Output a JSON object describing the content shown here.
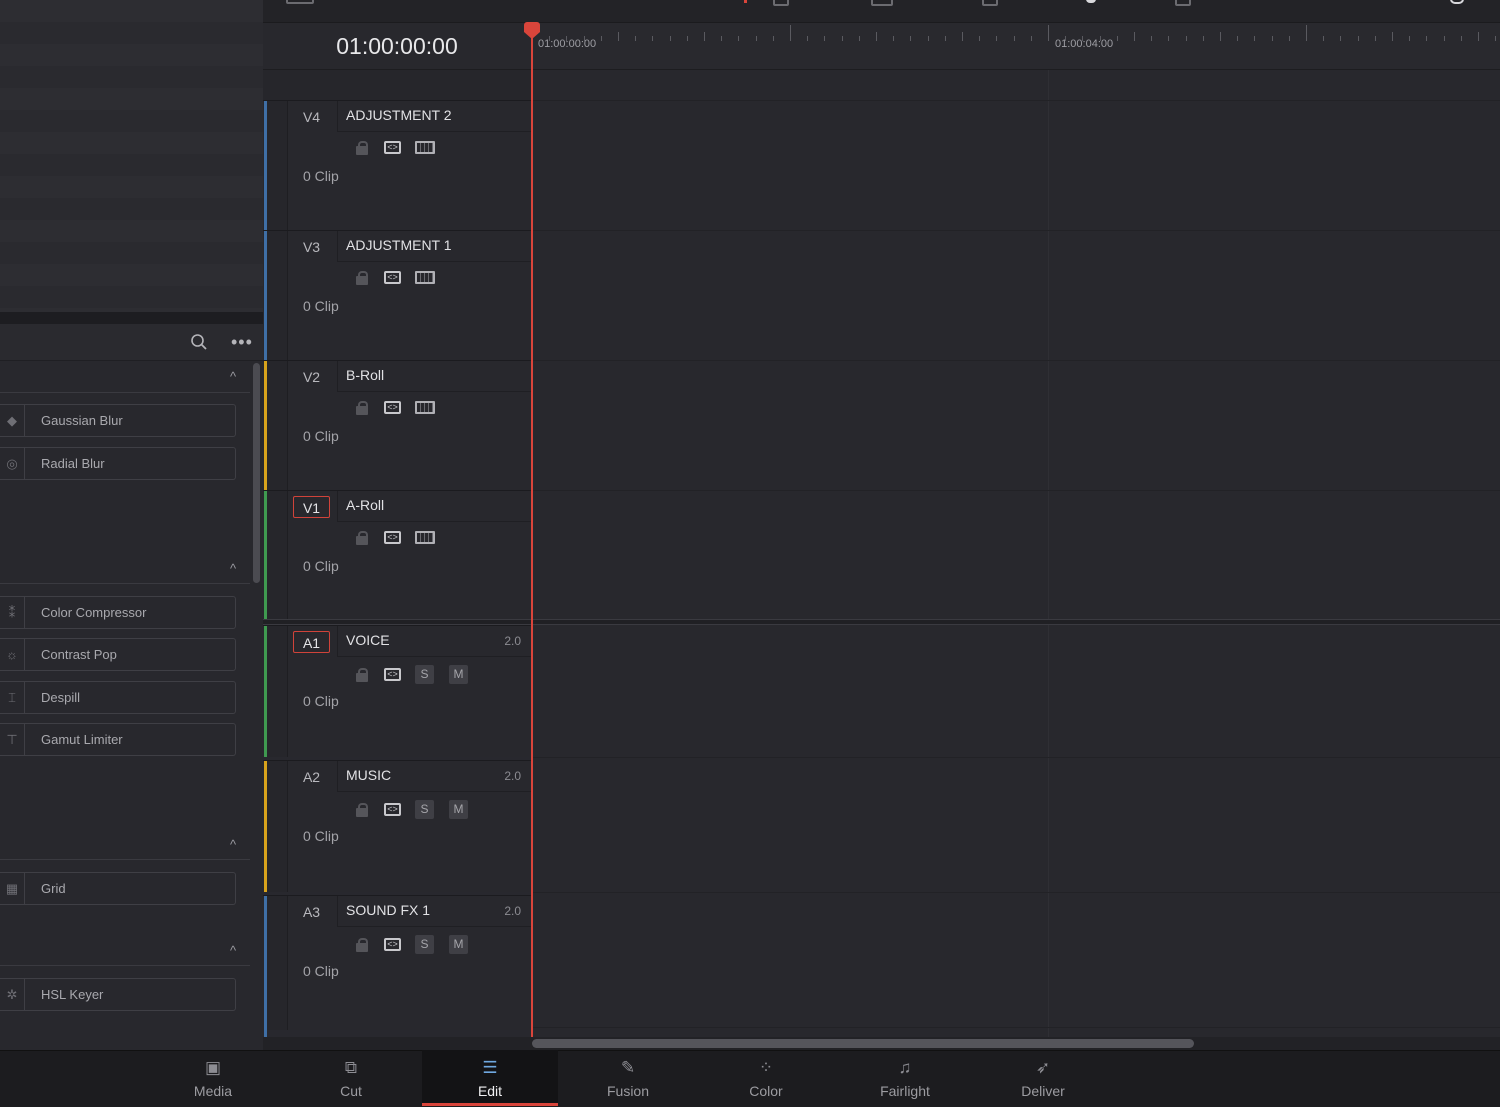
{
  "timeline": {
    "timecode": "01:00:00:00",
    "ruler_labels": [
      "01:00:00:00",
      "01:00:04:00"
    ]
  },
  "video_tracks": [
    {
      "id": "V4",
      "name": "ADJUSTMENT 2",
      "clips": "0 Clip",
      "color": "#3f6fa6",
      "active": false
    },
    {
      "id": "V3",
      "name": "ADJUSTMENT 1",
      "clips": "0 Clip",
      "color": "#3f6fa6",
      "active": false
    },
    {
      "id": "V2",
      "name": "B-Roll",
      "clips": "0 Clip",
      "color": "#d8a31c",
      "active": false
    },
    {
      "id": "V1",
      "name": "A-Roll",
      "clips": "0 Clip",
      "color": "#3f9a50",
      "active": true
    }
  ],
  "audio_tracks": [
    {
      "id": "A1",
      "name": "VOICE",
      "channels": "2.0",
      "clips": "0 Clip",
      "color": "#3f9a50",
      "active": true,
      "solo": "S",
      "mute": "M"
    },
    {
      "id": "A2",
      "name": "MUSIC",
      "channels": "2.0",
      "clips": "0 Clip",
      "color": "#d8a31c",
      "active": false,
      "solo": "S",
      "mute": "M"
    },
    {
      "id": "A3",
      "name": "SOUND FX 1",
      "channels": "2.0",
      "clips": "0 Clip",
      "color": "#3f6fa6",
      "active": false,
      "solo": "S",
      "mute": "M"
    }
  ],
  "effects": {
    "groups": [
      {
        "items": [
          {
            "label": "Gaussian Blur",
            "icon": "drop-icon"
          },
          {
            "label": "Radial Blur",
            "icon": "radial-icon"
          }
        ]
      },
      {
        "items": [
          {
            "label": "Color Compressor",
            "icon": "compress-icon"
          },
          {
            "label": "Contrast Pop",
            "icon": "sun-icon"
          },
          {
            "label": "Despill",
            "icon": "despill-icon"
          },
          {
            "label": "Gamut Limiter",
            "icon": "limiter-icon"
          }
        ]
      },
      {
        "items": [
          {
            "label": "Grid",
            "icon": "grid-icon"
          }
        ]
      },
      {
        "items": [
          {
            "label": "HSL Keyer",
            "icon": "keyer-icon"
          }
        ]
      }
    ]
  },
  "pages": [
    {
      "label": "Media",
      "icon": "media-icon",
      "active": false
    },
    {
      "label": "Cut",
      "icon": "cut-icon",
      "active": false
    },
    {
      "label": "Edit",
      "icon": "edit-icon",
      "active": true
    },
    {
      "label": "Fusion",
      "icon": "fusion-icon",
      "active": false
    },
    {
      "label": "Color",
      "icon": "color-icon",
      "active": false
    },
    {
      "label": "Fairlight",
      "icon": "fairlight-icon",
      "active": false
    },
    {
      "label": "Deliver",
      "icon": "deliver-icon",
      "active": false
    }
  ],
  "colors": {
    "accent": "#d9453b",
    "video_blue": "#3f6fa6",
    "yellow": "#d8a31c",
    "green": "#3f9a50"
  }
}
